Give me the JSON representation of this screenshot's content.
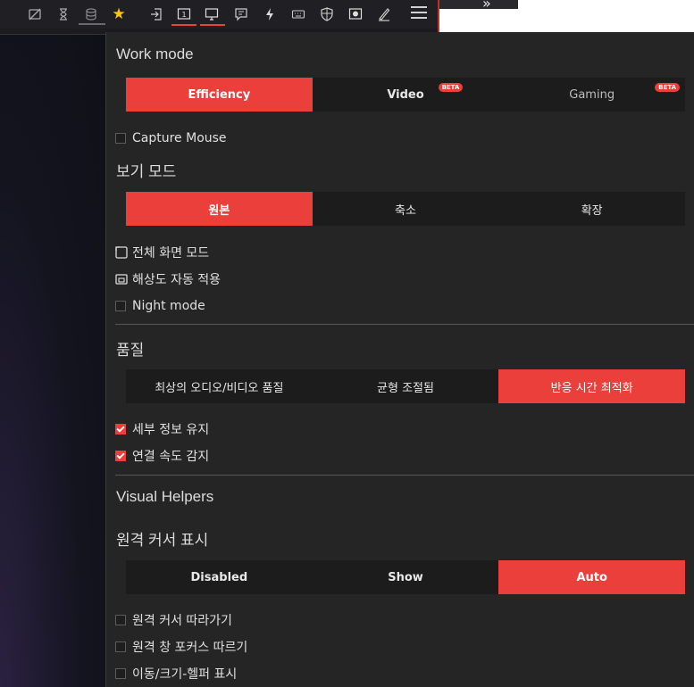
{
  "toolbar": {
    "icons": [
      "eye-off-icon",
      "hourglass-icon",
      "database-icon",
      "star-icon",
      "login-icon",
      "screen-1-icon",
      "monitor-icon",
      "chat-icon",
      "lightning-icon",
      "keyboard-icon",
      "shield-icon",
      "record-icon",
      "pen-icon",
      "menu-icon"
    ],
    "screen_number": "1",
    "overflow_glyph": "»",
    "accent": "#ea3f3a",
    "star_color": "#f5c518"
  },
  "work_mode": {
    "title": "Work mode",
    "options": [
      "Efficiency",
      "Video",
      "Gaming"
    ],
    "beta_label": "BETA",
    "selected": "Efficiency"
  },
  "capture_mouse": {
    "label": "Capture Mouse",
    "checked": false
  },
  "view_mode": {
    "title": "보기 모드",
    "options": [
      "원본",
      "축소",
      "확장"
    ],
    "selected": "원본"
  },
  "view_options": [
    {
      "label": "전체 화면 모드",
      "icon": "fullscreen-icon"
    },
    {
      "label": "해상도 자동 적용",
      "icon": "resolution-icon"
    },
    {
      "label": "Night mode",
      "checked": false
    }
  ],
  "quality": {
    "title": "품질",
    "options": [
      "최상의 오디오/비디오 품질",
      "균형 조절됨",
      "반응 시간 최적화"
    ],
    "selected": "반응 시간 최적화"
  },
  "quality_options": [
    {
      "label": "세부 정보 유지",
      "checked": true
    },
    {
      "label": "연결 속도 감지",
      "checked": true
    }
  ],
  "visual_helpers": {
    "title": "Visual Helpers",
    "cursor_title": "원격 커서 표시",
    "cursor_options": [
      "Disabled",
      "Show",
      "Auto"
    ],
    "selected": "Auto",
    "options": [
      {
        "label": "원격 커서 따라가기",
        "checked": false
      },
      {
        "label": "원격 창 포커스 따르기",
        "checked": false
      },
      {
        "label": "이동/크기-헬퍼 표시",
        "checked": false
      }
    ]
  }
}
